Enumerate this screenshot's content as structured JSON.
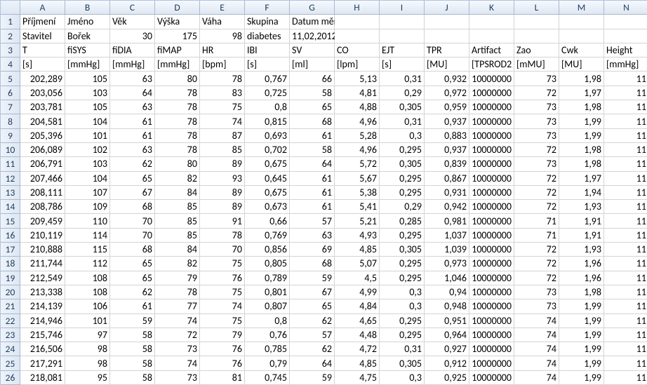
{
  "columns": [
    "A",
    "B",
    "C",
    "D",
    "E",
    "F",
    "G",
    "H",
    "I",
    "J",
    "K",
    "L",
    "M",
    "N"
  ],
  "rowCount": 26,
  "textCells": {
    "1": {
      "A": "Příjmení",
      "B": "Jméno",
      "C": "Věk",
      "D": "Výška",
      "E": "Váha",
      "F": "Skupina",
      "G": "Datum měření"
    },
    "2": {
      "A": "Stavitel",
      "B": "Bořek",
      "F": "diabetes",
      "G": "11,02,2012"
    },
    "3": {
      "A": "T",
      "B": "fiSYS",
      "C": "fiDIA",
      "D": "fiMAP",
      "E": "HR",
      "F": "IBI",
      "G": "SV",
      "H": "CO",
      "I": "EJT",
      "J": "TPR",
      "K": "Artifact",
      "L": "Zao",
      "M": "Cwk",
      "N": "Height"
    },
    "4": {
      "A": "[s]",
      "B": "[mmHg]",
      "C": "[mmHg]",
      "D": "[mmHg]",
      "E": "[bpm]",
      "F": "[s]",
      "G": "[ml]",
      "H": "[lpm]",
      "I": "[s]",
      "J": "[MU]",
      "K": "[TPSROD2",
      "L": "[mMU]",
      "M": "[MU]",
      "N": "[mmHg]"
    }
  },
  "numCells": {
    "2": {
      "C": "30",
      "D": "175",
      "E": "98"
    }
  },
  "dataRows": [
    [
      "202,289",
      "105",
      "63",
      "80",
      "78",
      "0,767",
      "66",
      "5,13",
      "0,31",
      "0,932",
      "10000000",
      "73",
      "1,98",
      "11"
    ],
    [
      "203,056",
      "103",
      "64",
      "78",
      "83",
      "0,725",
      "58",
      "4,81",
      "0,29",
      "0,972",
      "10000000",
      "72",
      "1,97",
      "11"
    ],
    [
      "203,781",
      "105",
      "63",
      "78",
      "75",
      "0,8",
      "65",
      "4,88",
      "0,305",
      "0,959",
      "10000000",
      "73",
      "1,98",
      "11"
    ],
    [
      "204,581",
      "104",
      "61",
      "78",
      "74",
      "0,815",
      "68",
      "4,96",
      "0,31",
      "0,937",
      "10000000",
      "73",
      "1,99",
      "11"
    ],
    [
      "205,396",
      "101",
      "61",
      "78",
      "87",
      "0,693",
      "61",
      "5,28",
      "0,3",
      "0,883",
      "10000000",
      "73",
      "1,99",
      "11"
    ],
    [
      "206,089",
      "102",
      "63",
      "78",
      "85",
      "0,702",
      "58",
      "4,96",
      "0,295",
      "0,937",
      "10000000",
      "72",
      "1,98",
      "11"
    ],
    [
      "206,791",
      "103",
      "62",
      "80",
      "89",
      "0,675",
      "64",
      "5,72",
      "0,305",
      "0,839",
      "10000000",
      "73",
      "1,98",
      "11"
    ],
    [
      "207,466",
      "104",
      "65",
      "82",
      "93",
      "0,645",
      "61",
      "5,67",
      "0,295",
      "0,867",
      "10000000",
      "72",
      "1,97",
      "11"
    ],
    [
      "208,111",
      "107",
      "67",
      "84",
      "89",
      "0,675",
      "61",
      "5,38",
      "0,295",
      "0,931",
      "10000000",
      "72",
      "1,94",
      "11"
    ],
    [
      "208,786",
      "109",
      "68",
      "85",
      "89",
      "0,673",
      "61",
      "5,41",
      "0,29",
      "0,942",
      "10000000",
      "72",
      "1,93",
      "11"
    ],
    [
      "209,459",
      "110",
      "70",
      "85",
      "91",
      "0,66",
      "57",
      "5,21",
      "0,285",
      "0,981",
      "10000000",
      "71",
      "1,91",
      "11"
    ],
    [
      "210,119",
      "114",
      "70",
      "85",
      "78",
      "0,769",
      "63",
      "4,93",
      "0,295",
      "1,037",
      "10000000",
      "71",
      "1,91",
      "11"
    ],
    [
      "210,888",
      "115",
      "68",
      "84",
      "70",
      "0,856",
      "69",
      "4,85",
      "0,305",
      "1,039",
      "10000000",
      "72",
      "1,93",
      "11"
    ],
    [
      "211,744",
      "112",
      "65",
      "82",
      "75",
      "0,805",
      "68",
      "5,07",
      "0,295",
      "0,973",
      "10000000",
      "72",
      "1,96",
      "11"
    ],
    [
      "212,549",
      "108",
      "65",
      "79",
      "76",
      "0,789",
      "59",
      "4,5",
      "0,295",
      "1,046",
      "10000000",
      "72",
      "1,96",
      "11"
    ],
    [
      "213,338",
      "108",
      "62",
      "78",
      "75",
      "0,801",
      "67",
      "4,99",
      "0,3",
      "0,94",
      "10000000",
      "73",
      "1,98",
      "11"
    ],
    [
      "214,139",
      "106",
      "61",
      "77",
      "74",
      "0,807",
      "65",
      "4,84",
      "0,3",
      "0,948",
      "10000000",
      "73",
      "1,99",
      "11"
    ],
    [
      "214,946",
      "101",
      "59",
      "74",
      "75",
      "0,8",
      "62",
      "4,65",
      "0,295",
      "0,951",
      "10000000",
      "74",
      "1,99",
      "11"
    ],
    [
      "215,746",
      "97",
      "58",
      "72",
      "79",
      "0,76",
      "57",
      "4,48",
      "0,295",
      "0,964",
      "10000000",
      "74",
      "1,99",
      "11"
    ],
    [
      "216,506",
      "98",
      "58",
      "73",
      "76",
      "0,785",
      "62",
      "4,72",
      "0,31",
      "0,927",
      "10000000",
      "74",
      "1,99",
      "11"
    ],
    [
      "217,291",
      "98",
      "58",
      "74",
      "76",
      "0,79",
      "64",
      "4,85",
      "0,305",
      "0,912",
      "10000000",
      "74",
      "1,99",
      "11"
    ],
    [
      "218,081",
      "95",
      "58",
      "73",
      "81",
      "0,745",
      "59",
      "4,75",
      "0,3",
      "0,925",
      "10000000",
      "74",
      "1,99",
      "11"
    ]
  ]
}
